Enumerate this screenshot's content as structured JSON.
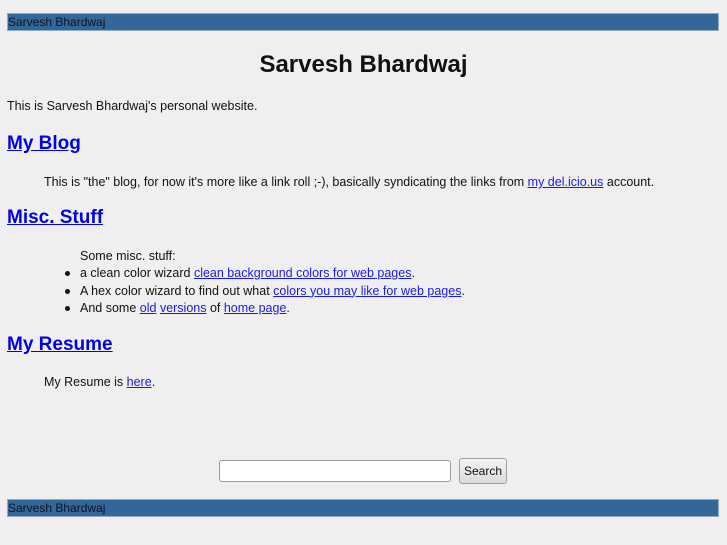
{
  "header": {
    "bar_text": "Sarvesh Bhardwaj",
    "bar_color": "#336699"
  },
  "page": {
    "title": "Sarvesh Bhardwaj",
    "intro": "This is Sarvesh Bhardwaj's personal website."
  },
  "sections": {
    "blog": {
      "heading": "My Blog",
      "text_before": "This is \"the\" blog, for now it's more like a link roll ;-), basically syndicating the links from ",
      "link_text": "my del.icio.us",
      "text_after": " account."
    },
    "misc": {
      "heading": "Misc. Stuff",
      "intro": "Some misc. stuff:",
      "items": [
        {
          "text_before": "a clean color wizard ",
          "link_text": "clean background colors for web pages",
          "text_after": "."
        },
        {
          "text_before": "A hex color wizard to find out what ",
          "link_text": "colors you may like for web pages",
          "text_after": "."
        },
        {
          "text_before": "And some ",
          "link1_text": "old",
          "link2_text": "versions",
          "middle_text": " of ",
          "link3_text": "home page",
          "text_after": "."
        }
      ]
    },
    "resume": {
      "heading": "My Resume",
      "text_before": "My Resume is ",
      "link_text": "here",
      "text_after": "."
    }
  },
  "search": {
    "input_value": "",
    "placeholder": "",
    "button_label": "Search"
  },
  "footer": {
    "bar_text": "Sarvesh Bhardwaj"
  },
  "colors": {
    "background": "#efefef",
    "link": "#0000ee",
    "bar": "#336699"
  }
}
